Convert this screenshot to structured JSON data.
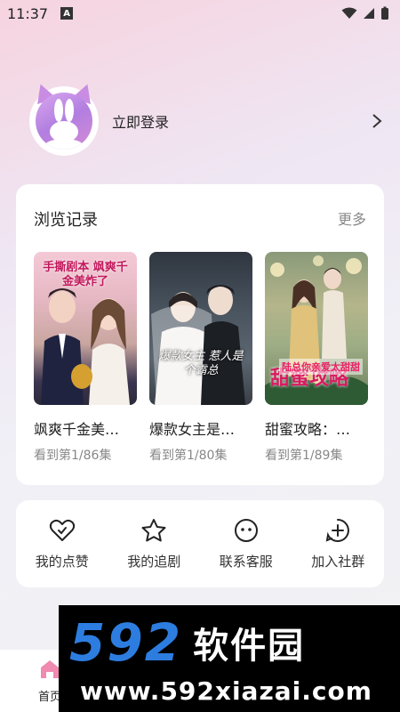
{
  "status_bar": {
    "time": "11:37",
    "a_badge": "A"
  },
  "profile": {
    "login_label": "立即登录"
  },
  "history": {
    "heading": "浏览记录",
    "more_label": "更多",
    "items": [
      {
        "title": "飒爽千金美…",
        "progress": "看到第1/86集",
        "poster_text": "手撕剧本 飒爽千金美炸了"
      },
      {
        "title": "爆款女主是…",
        "progress": "看到第1/80集",
        "poster_text": "爆款女主 惹人是个霸总"
      },
      {
        "title": "甜蜜攻略：…",
        "progress": "看到第1/89集",
        "poster_text": "甜蜜攻略",
        "poster_sub": "陆总你亲爱太甜甜"
      }
    ]
  },
  "actions": [
    {
      "label": "我的点赞",
      "icon": "heart-check-icon"
    },
    {
      "label": "我的追剧",
      "icon": "star-icon"
    },
    {
      "label": "联系客服",
      "icon": "chat-face-icon"
    },
    {
      "label": "加入社群",
      "icon": "plus-circle-icon"
    }
  ],
  "tabbar": {
    "home_label": "首页"
  },
  "watermark": {
    "number": "592",
    "name": "软件园",
    "url": "www.592xiazai.com"
  },
  "colors": {
    "accent": "#2d7de0",
    "avatar": "#c98ce3"
  }
}
